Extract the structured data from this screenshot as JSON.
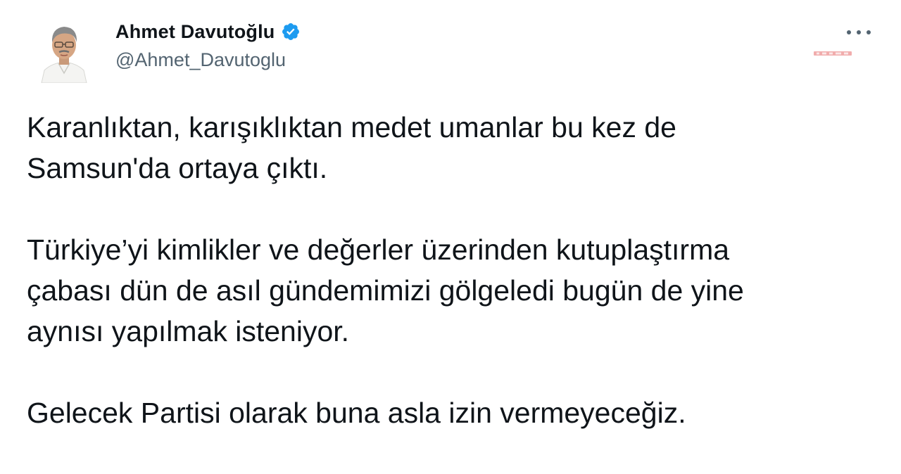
{
  "author": {
    "display_name": "Ahmet Davutoğlu",
    "handle": "@Ahmet_Davutoglu",
    "verified": true,
    "avatar_icon": "profile-photo"
  },
  "menu": {
    "icon": "more-horizontal-icon"
  },
  "colors": {
    "verified_blue": "#1d9bf0",
    "text": "#0f1419",
    "secondary_text": "#536471"
  },
  "tweet": {
    "paragraphs": [
      {
        "lines": [
          "Karanlıktan, karışıklıktan medet umanlar bu kez de",
          "Samsun'da ortaya çıktı."
        ]
      },
      {
        "lines": [
          "Türkiye’yi kimlikler ve değerler üzerinden kutuplaştırma",
          "çabası dün de asıl gündemimizi gölgeledi bugün de yine",
          "aynısı yapılmak isteniyor."
        ]
      },
      {
        "lines": [
          "Gelecek Partisi olarak buna asla izin vermeyeceğiz."
        ]
      }
    ]
  }
}
